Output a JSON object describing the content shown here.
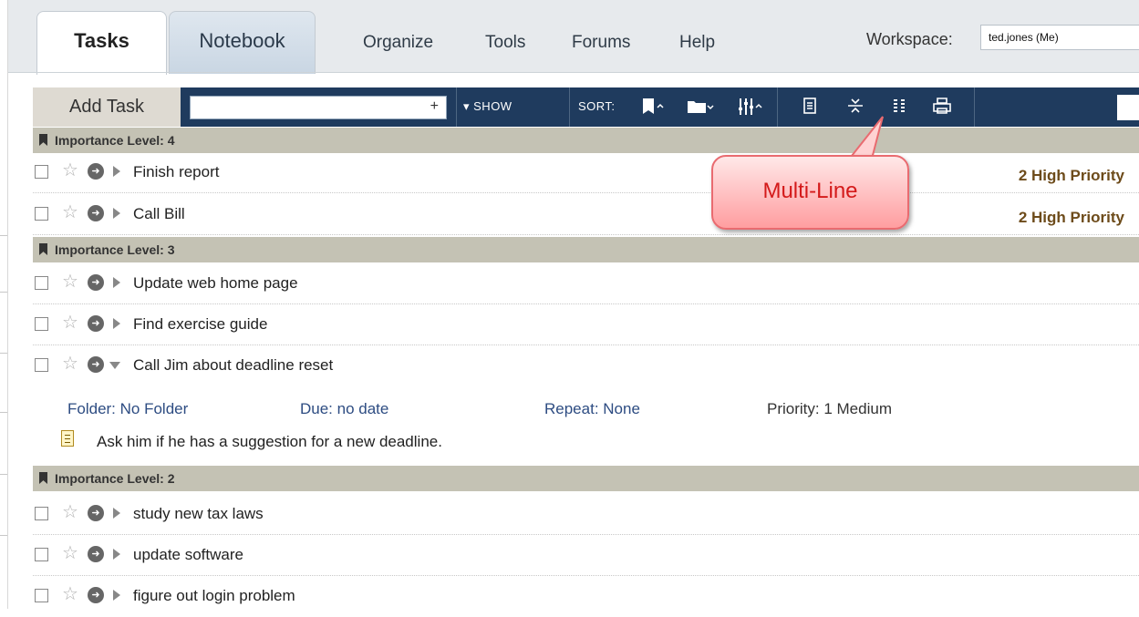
{
  "nav": {
    "tabs": [
      {
        "label": "Tasks",
        "active": true
      },
      {
        "label": "Notebook",
        "active": false
      }
    ],
    "links": [
      "Organize",
      "Tools",
      "Forums",
      "Help"
    ],
    "workspace_label": "Workspace:",
    "workspace_value": "ted.jones (Me)"
  },
  "toolbar": {
    "add_task_label": "Add Task",
    "plus": "+",
    "show_label": "▾ SHOW",
    "sort_label": "SORT:",
    "icons": [
      "bookmark-sort-icon",
      "folder-sort-icon",
      "filter-sort-icon",
      "note-icon",
      "collapse-icon",
      "multi-line-icon",
      "print-icon"
    ]
  },
  "groups": [
    {
      "label": "Importance Level: 4",
      "tasks": [
        {
          "title": "Finish report",
          "priority": "2 High Priority"
        },
        {
          "title": "Call Bill",
          "priority": "2 High Priority"
        }
      ]
    },
    {
      "label": "Importance Level: 3",
      "tasks": [
        {
          "title": "Update web home page",
          "priority": ""
        },
        {
          "title": "Find exercise guide",
          "priority": ""
        },
        {
          "title": "Call Jim about deadline reset",
          "priority": "",
          "expanded": true
        }
      ]
    },
    {
      "label": "Importance Level: 2",
      "tasks": [
        {
          "title": "study new tax laws",
          "priority": ""
        },
        {
          "title": "update software",
          "priority": ""
        },
        {
          "title": "figure out login problem",
          "priority": ""
        }
      ]
    }
  ],
  "expanded_detail": {
    "folder": "Folder: No Folder",
    "due": "Due: no date",
    "repeat": "Repeat: None",
    "priority": "Priority: 1 Medium",
    "note": "Ask him if he has a suggestion for a new deadline."
  },
  "callout": {
    "text": "Multi-Line"
  },
  "colors": {
    "toolbar_bg": "#1f3b5e",
    "group_header_bg": "#c4c2b4",
    "priority_text": "#6d4b1a",
    "detail_link": "#2d4c82",
    "callout_text": "#d41a1a"
  }
}
